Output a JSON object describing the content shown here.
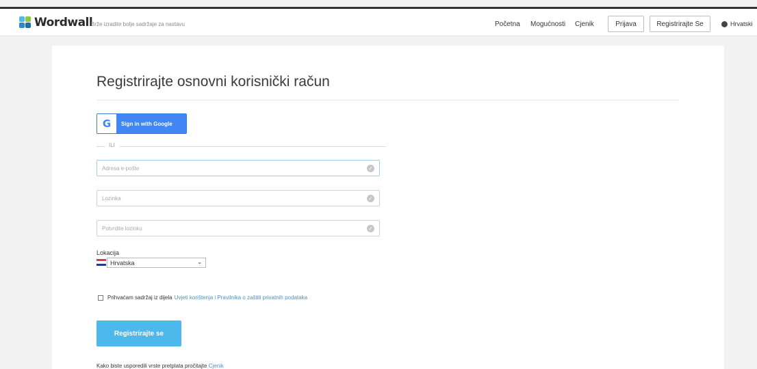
{
  "header": {
    "logo_text": "Wordwall",
    "tagline": "Brže izradite bolje sadržaje za nastavu",
    "nav": {
      "home": "Početna",
      "features": "Mogućnosti",
      "pricing": "Cjenik",
      "login": "Prijava",
      "register": "Registrirajte Se"
    },
    "language": "Hrvatski"
  },
  "form": {
    "title": "Registrirajte osnovni korisnički račun",
    "google_label": "Sign in with Google",
    "google_letter": "G",
    "separator": "ILI",
    "email_placeholder": "Adresa e-pošte",
    "password_placeholder": "Lozinka",
    "confirm_placeholder": "Potvrdite lozinku",
    "location_label": "Lokacija",
    "location_value": "Hrvatska",
    "terms_text": "Prihvaćam sadržaj iz dijela",
    "terms_link": "Uvjeti korištenja i Pravilnika o zaštiti privatnih podataka",
    "submit_label": "Registrirajte se",
    "footer_text": "Kako biste usporedili vrste pretplata pročitajte",
    "footer_link": "Cjenik"
  },
  "icons": {
    "field_valid": "check-circle-icon",
    "dropdown": "chevron-down-icon",
    "globe": "globe-icon"
  },
  "colors": {
    "google_blue": "#4285f4",
    "register_button": "#4db8ec",
    "link": "#4a90c8"
  }
}
